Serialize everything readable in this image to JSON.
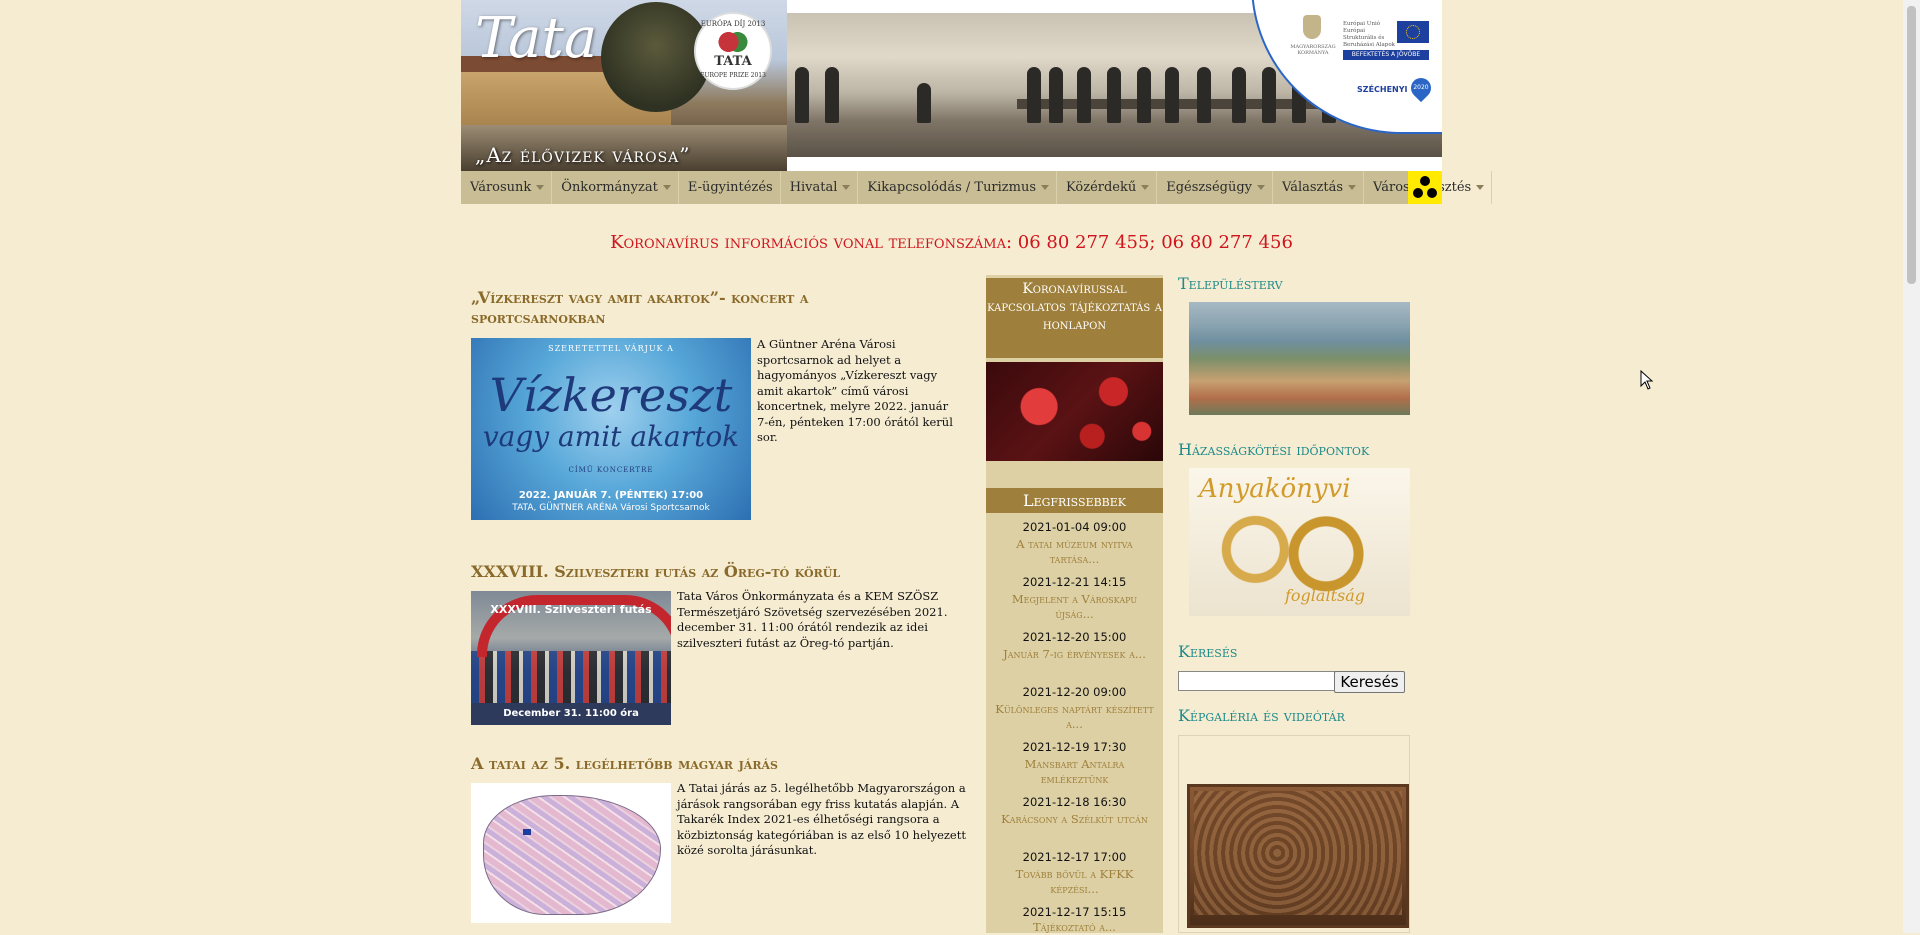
{
  "header": {
    "logo_script": "Tata",
    "motto": "„Az élővizek városa”",
    "prize_top": "EURÓPA DÍJ 2013",
    "prize_name": "TATA",
    "prize_bottom": "EUROPE PRIZE 2013",
    "eu_country": "MAGYARORSZÁG KORMÁNYA",
    "eu_text": "Európai Unió Európai Strukturális és Beruházási Alapok",
    "eu_bar": "BEFEKTETÉS A JÖVŐBE",
    "szechenyi": "SZÉCHENYI",
    "szechenyi_year": "2020"
  },
  "nav": {
    "items": [
      {
        "label": "Városunk",
        "caret": true
      },
      {
        "label": "Önkormányzat",
        "caret": true
      },
      {
        "label": "E-ügyintézés",
        "caret": false
      },
      {
        "label": "Hivatal",
        "caret": true
      },
      {
        "label": "Kikapcsolódás / Turizmus",
        "caret": true
      },
      {
        "label": "Közérdekű",
        "caret": true
      },
      {
        "label": "Egészségügy",
        "caret": true
      },
      {
        "label": "Választás",
        "caret": true
      },
      {
        "label": "Városfejlesztés",
        "caret": true
      }
    ],
    "accessibility_icon": "accessibility-icon"
  },
  "hotline": "Koronavírus információs vonal telefonszáma: 06 80 277 455; 06 80 277 456",
  "articles": [
    {
      "title": "„Vízkereszt vagy amit akartok”- koncert a sportcsarnokban",
      "text": "A Güntner Aréna Városi sportcsarnok ad helyet a hagyományos „Vízkereszt vagy amit akartok” című városi koncertnek, melyre 2022. január 7-én, pénteken 17:00 órától kerül sor.",
      "image": {
        "top": "SZERETETTEL VÁRJUK A",
        "big": "Vízkereszt",
        "mid": "vagy amit akartok",
        "small": "CÍMŰ KONCERTRE",
        "date": "2022. JANUÁR 7. (PÉNTEK) 17:00",
        "place": "TATA, GÜNTNER ARÉNA Városi Sportcsarnok"
      }
    },
    {
      "title": "XXXVIII. Szilveszteri futás az Öreg-tó körül",
      "text": "Tata Város Önkormányzata és a KEM SZÖSZ Természetjáró Szövetség szervezésében 2021. december 31. 11:00 órától rendezik az idei szilveszteri futást az Öreg-tó partján.",
      "image": {
        "title": "XXXVIII. Szilveszteri futás",
        "banner": "December 31. 11:00 óra"
      }
    },
    {
      "title": "A tatai az 5. legélhetőbb magyar járás",
      "text": "A Tatai járás az 5. legélhetőbb Magyarországon a járások rangsorában egy friss kutatás alapján. A Takarék Index 2021-es élhetőségi rangsora a közbiztonság kategóriában is az első 10 helyezett közé sorolta járásunkat."
    }
  ],
  "middle": {
    "covid_box": "Koronavírussal kapcsolatos tájékoztatás a honlapon",
    "latest_header": "Legfrissebbek",
    "news": [
      {
        "date": "2021-01-04 09:00",
        "title": "A tatai múzeum nyitva tartása..."
      },
      {
        "date": "2021-12-21 14:15",
        "title": "Megjelent a Városkapu újság..."
      },
      {
        "date": "2021-12-20 15:00",
        "title": "Január 7-ig érvényesek a..."
      },
      {
        "date": "2021-12-20 09:00",
        "title": "Különleges naptárt készített a..."
      },
      {
        "date": "2021-12-19 17:30",
        "title": "Mansbart Antalra emlékeztünk"
      },
      {
        "date": "2021-12-18 16:30",
        "title": "Karácsony a Szélkút utcán"
      },
      {
        "date": "2021-12-17 17:00",
        "title": "Tovább bővül a KFKK képzési..."
      },
      {
        "date": "2021-12-17 15:15",
        "title": "Tájékoztató a..."
      }
    ]
  },
  "right": {
    "plan_title": "Településterv",
    "wedding_title": "Házasságkötési időpontok",
    "wedding_img_top": "Anyakönyvi",
    "wedding_img_bottom": "foglaltság",
    "search_title": "Keresés",
    "search_value": "",
    "search_button": "Keresés",
    "gallery_title": "Képgaléria és videótár"
  }
}
